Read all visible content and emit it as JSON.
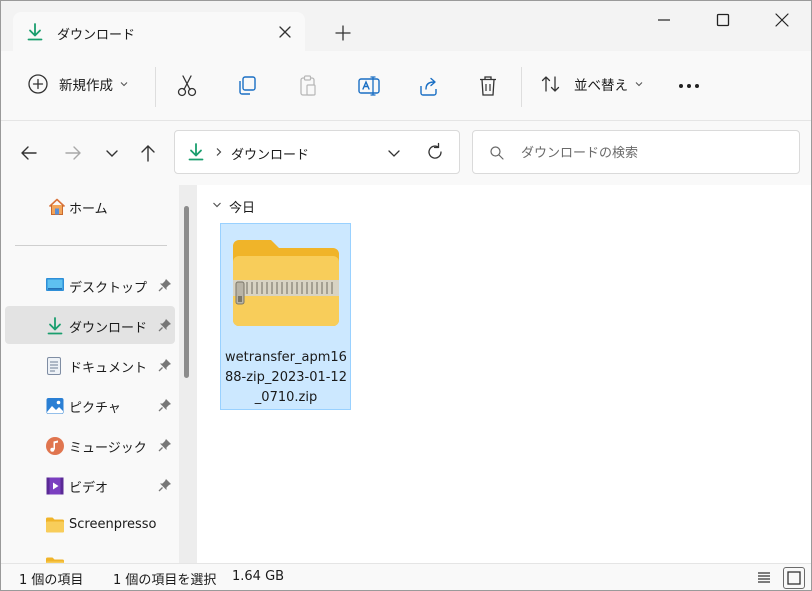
{
  "window": {
    "tab_title": "ダウンロード"
  },
  "toolbar": {
    "new_label": "新規作成",
    "sort_label": "並べ替え"
  },
  "address": {
    "crumb": "ダウンロード"
  },
  "search": {
    "placeholder": "ダウンロードの検索"
  },
  "sidebar": {
    "home": "ホーム",
    "items": [
      {
        "label": "デスクトップ",
        "icon": "desktop-icon",
        "pinned": true
      },
      {
        "label": "ダウンロード",
        "icon": "download-icon",
        "pinned": true,
        "selected": true
      },
      {
        "label": "ドキュメント",
        "icon": "document-icon",
        "pinned": true
      },
      {
        "label": "ピクチャ",
        "icon": "pictures-icon",
        "pinned": true
      },
      {
        "label": "ミュージック",
        "icon": "music-icon",
        "pinned": true
      },
      {
        "label": "ビデオ",
        "icon": "video-icon",
        "pinned": true
      },
      {
        "label": "Screenpresso",
        "icon": "folder-icon",
        "pinned": false
      }
    ]
  },
  "content": {
    "group_label": "今日",
    "files": [
      {
        "name": "wetransfer_apm1688-zip_2023-01-12_0710.zip",
        "icon": "zip-folder-icon"
      }
    ]
  },
  "status": {
    "count": "1 個の項目",
    "selection": "1 個の項目を選択",
    "size": "1.64 GB"
  },
  "colors": {
    "accent_green": "#1a9e6e",
    "selection_bg": "#cce8ff",
    "selection_border": "#99d1ff",
    "folder_yellow": "#f6c343"
  }
}
